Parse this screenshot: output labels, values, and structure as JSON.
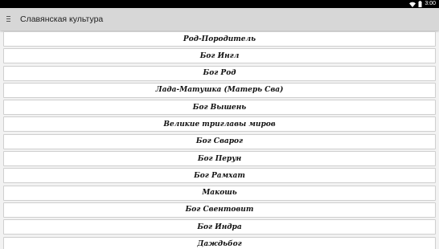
{
  "status_bar": {
    "time": "3:00",
    "icons": [
      "wifi-icon",
      "battery-icon"
    ]
  },
  "app_bar": {
    "title": "Славянская культура",
    "menu_icon": "menu-icon"
  },
  "items": [
    {
      "label": "Род-Породитель"
    },
    {
      "label": "Бог Ингл"
    },
    {
      "label": "Бог Род"
    },
    {
      "label": "Лада-Матушка (Матерь Сва)"
    },
    {
      "label": "Бог Вышень"
    },
    {
      "label": "Великие триглавы миров"
    },
    {
      "label": "Бог Сварог"
    },
    {
      "label": "Бог Перун"
    },
    {
      "label": "Бог Рамхат"
    },
    {
      "label": "Макошь"
    },
    {
      "label": "Бог Свентовит"
    },
    {
      "label": "Бог Индра"
    },
    {
      "label": "Даждьбог"
    }
  ]
}
